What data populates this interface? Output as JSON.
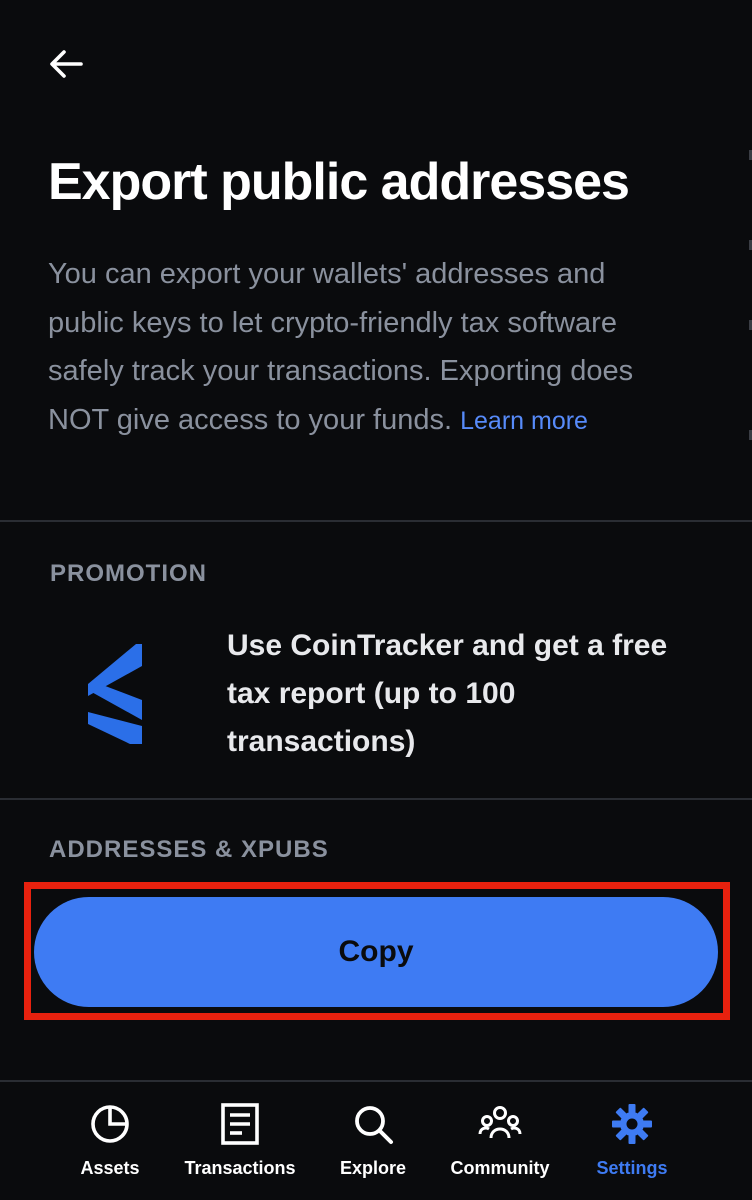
{
  "header": {
    "back_icon": "arrow-left-icon"
  },
  "page": {
    "title": "Export public addresses",
    "description": "You can export your wallets' addresses and public keys to let crypto-friendly tax software safely track your transactions. Exporting does NOT give access to your funds.",
    "learn_more": "Learn more"
  },
  "promotion": {
    "section_label": "PROMOTION",
    "logo_icon": "cointracker-logo-icon",
    "text": "Use CoinTracker and get a free tax report (up to 100 transactions)"
  },
  "addresses": {
    "section_label": "ADDRESSES & XPUBS",
    "copy_label": "Copy"
  },
  "tabs": [
    {
      "label": "Assets",
      "icon": "pie-chart-icon",
      "active": false
    },
    {
      "label": "Transactions",
      "icon": "document-icon",
      "active": false
    },
    {
      "label": "Explore",
      "icon": "search-icon",
      "active": false
    },
    {
      "label": "Community",
      "icon": "people-icon",
      "active": false
    },
    {
      "label": "Settings",
      "icon": "gear-icon",
      "active": true
    }
  ],
  "colors": {
    "background": "#0a0b0d",
    "accent": "#3e7bf3",
    "link": "#578bfa",
    "muted_text": "#8a919e",
    "highlight": "#e8210e"
  }
}
